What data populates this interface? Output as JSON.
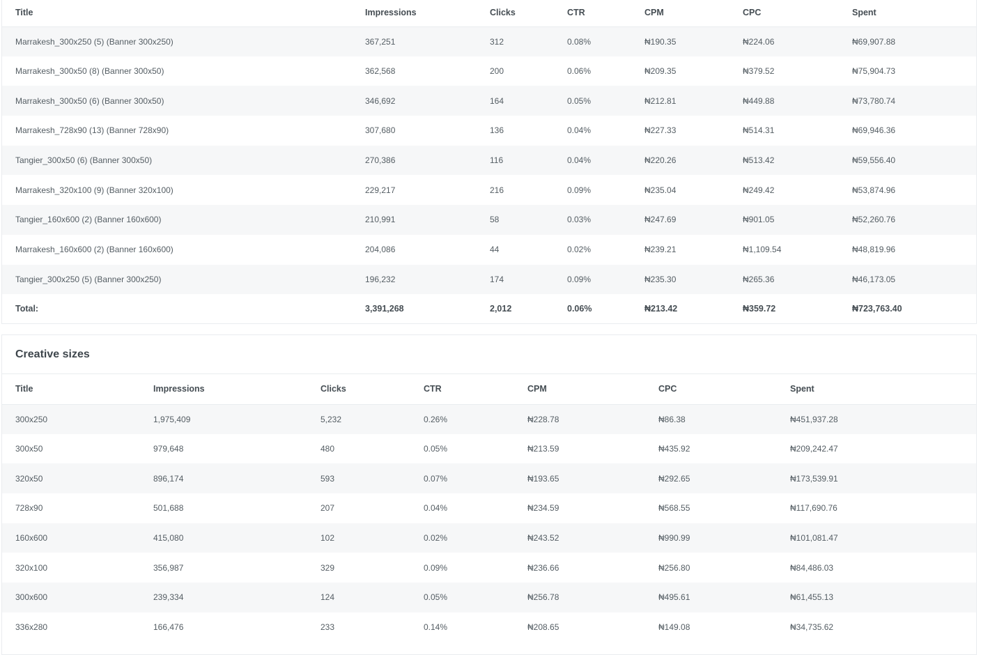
{
  "top_table": {
    "headers": [
      "Title",
      "Impressions",
      "Clicks",
      "CTR",
      "CPM",
      "CPC",
      "Spent"
    ],
    "rows": [
      [
        "Marrakesh_300x250 (5) (Banner 300x250)",
        "367,251",
        "312",
        "0.08%",
        "₦190.35",
        "₦224.06",
        "₦69,907.88"
      ],
      [
        "Marrakesh_300x50 (8) (Banner 300x50)",
        "362,568",
        "200",
        "0.06%",
        "₦209.35",
        "₦379.52",
        "₦75,904.73"
      ],
      [
        "Marrakesh_300x50 (6) (Banner 300x50)",
        "346,692",
        "164",
        "0.05%",
        "₦212.81",
        "₦449.88",
        "₦73,780.74"
      ],
      [
        "Marrakesh_728x90 (13) (Banner 728x90)",
        "307,680",
        "136",
        "0.04%",
        "₦227.33",
        "₦514.31",
        "₦69,946.36"
      ],
      [
        "Tangier_300x50 (6) (Banner 300x50)",
        "270,386",
        "116",
        "0.04%",
        "₦220.26",
        "₦513.42",
        "₦59,556.40"
      ],
      [
        "Marrakesh_320x100 (9) (Banner 320x100)",
        "229,217",
        "216",
        "0.09%",
        "₦235.04",
        "₦249.42",
        "₦53,874.96"
      ],
      [
        "Tangier_160x600 (2) (Banner 160x600)",
        "210,991",
        "58",
        "0.03%",
        "₦247.69",
        "₦901.05",
        "₦52,260.76"
      ],
      [
        "Marrakesh_160x600 (2) (Banner 160x600)",
        "204,086",
        "44",
        "0.02%",
        "₦239.21",
        "₦1,109.54",
        "₦48,819.96"
      ],
      [
        "Tangier_300x250 (5) (Banner 300x250)",
        "196,232",
        "174",
        "0.09%",
        "₦235.30",
        "₦265.36",
        "₦46,173.05"
      ]
    ],
    "total": [
      "Total:",
      "3,391,268",
      "2,012",
      "0.06%",
      "₦213.42",
      "₦359.72",
      "₦723,763.40"
    ]
  },
  "creative_sizes": {
    "title": "Creative sizes",
    "headers": [
      "Title",
      "Impressions",
      "Clicks",
      "CTR",
      "CPM",
      "CPC",
      "Spent"
    ],
    "rows": [
      [
        "300x250",
        "1,975,409",
        "5,232",
        "0.26%",
        "₦228.78",
        "₦86.38",
        "₦451,937.28"
      ],
      [
        "300x50",
        "979,648",
        "480",
        "0.05%",
        "₦213.59",
        "₦435.92",
        "₦209,242.47"
      ],
      [
        "320x50",
        "896,174",
        "593",
        "0.07%",
        "₦193.65",
        "₦292.65",
        "₦173,539.91"
      ],
      [
        "728x90",
        "501,688",
        "207",
        "0.04%",
        "₦234.59",
        "₦568.55",
        "₦117,690.76"
      ],
      [
        "160x600",
        "415,080",
        "102",
        "0.02%",
        "₦243.52",
        "₦990.99",
        "₦101,081.47"
      ],
      [
        "320x100",
        "356,987",
        "329",
        "0.09%",
        "₦236.66",
        "₦256.80",
        "₦84,486.03"
      ],
      [
        "300x600",
        "239,334",
        "124",
        "0.05%",
        "₦256.78",
        "₦495.61",
        "₦61,455.13"
      ],
      [
        "336x280",
        "166,476",
        "233",
        "0.14%",
        "₦208.65",
        "₦149.08",
        "₦34,735.62"
      ]
    ]
  }
}
